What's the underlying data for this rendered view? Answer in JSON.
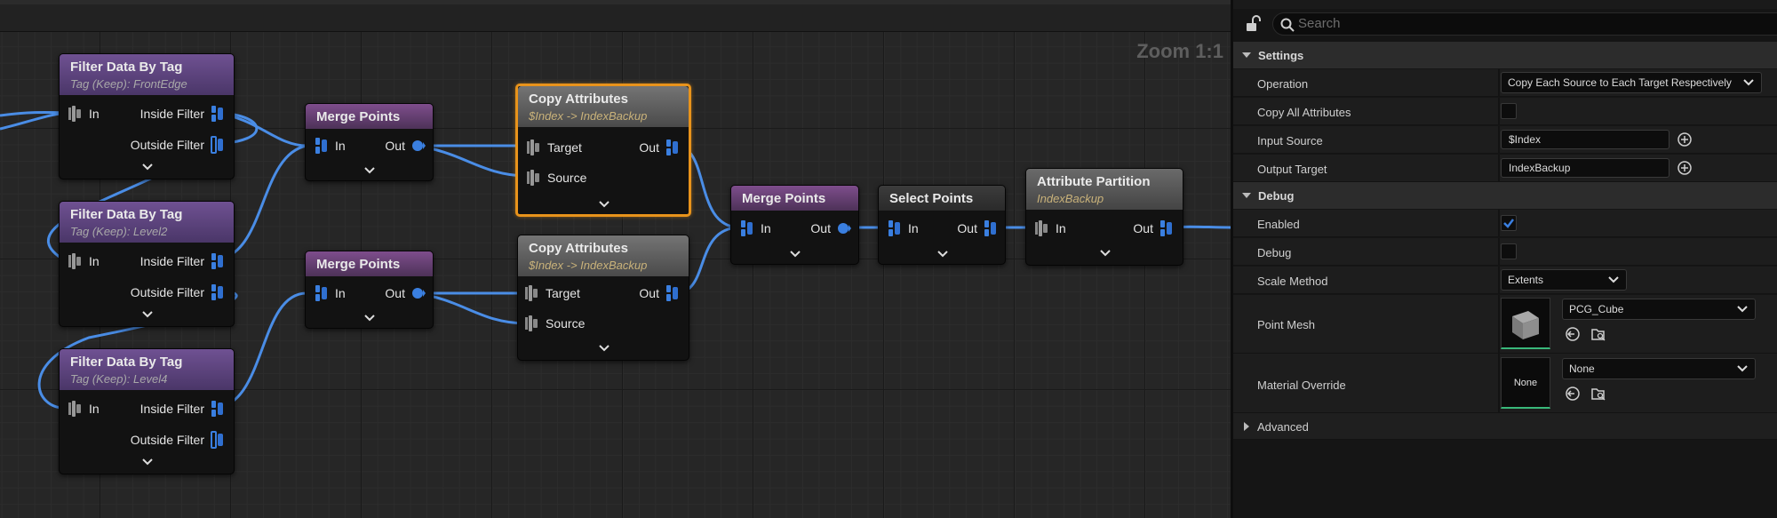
{
  "graph": {
    "zoom_label": "Zoom 1:1",
    "nodes": {
      "filter1": {
        "title": "Filter Data By Tag",
        "subtitle": "Tag (Keep): FrontEdge",
        "in": "In",
        "out1": "Inside Filter",
        "out2": "Outside Filter"
      },
      "filter2": {
        "title": "Filter Data By Tag",
        "subtitle": "Tag (Keep): Level2",
        "in": "In",
        "out1": "Inside Filter",
        "out2": "Outside Filter"
      },
      "filter3": {
        "title": "Filter Data By Tag",
        "subtitle": "Tag (Keep): Level4",
        "in": "In",
        "out1": "Inside Filter",
        "out2": "Outside Filter"
      },
      "merge1": {
        "title": "Merge Points",
        "in": "In",
        "out": "Out"
      },
      "merge2": {
        "title": "Merge Points",
        "in": "In",
        "out": "Out"
      },
      "copy1": {
        "title": "Copy Attributes",
        "subtitle": "$Index -> IndexBackup",
        "in1": "Target",
        "in2": "Source",
        "out": "Out"
      },
      "copy2": {
        "title": "Copy Attributes",
        "subtitle": "$Index -> IndexBackup",
        "in1": "Target",
        "in2": "Source",
        "out": "Out"
      },
      "merge3": {
        "title": "Merge Points",
        "in": "In",
        "out": "Out"
      },
      "select": {
        "title": "Select Points",
        "in": "In",
        "out": "Out"
      },
      "partition": {
        "title": "Attribute Partition",
        "subtitle": "IndexBackup",
        "in": "In",
        "out": "Out"
      }
    },
    "colors": {
      "pin_blue": "#3a7fe0",
      "selected_outline": "#e8931b",
      "wire": "#4a8de6"
    }
  },
  "details": {
    "search_placeholder": "Search",
    "sections": {
      "settings": "Settings",
      "debug": "Debug",
      "advanced": "Advanced"
    },
    "settings": {
      "operation_label": "Operation",
      "operation_value": "Copy Each Source to Each Target Respectively",
      "copy_all_label": "Copy All Attributes",
      "copy_all_checked": false,
      "input_source_label": "Input Source",
      "input_source_value": "$Index",
      "output_target_label": "Output Target",
      "output_target_value": "IndexBackup"
    },
    "debug": {
      "enabled_label": "Enabled",
      "enabled_checked": true,
      "debug_label": "Debug",
      "debug_checked": false,
      "scale_method_label": "Scale Method",
      "scale_method_value": "Extents",
      "point_mesh_label": "Point Mesh",
      "point_mesh_value": "PCG_Cube",
      "material_override_label": "Material Override",
      "material_override_value": "None",
      "material_thumb_text": "None"
    }
  }
}
